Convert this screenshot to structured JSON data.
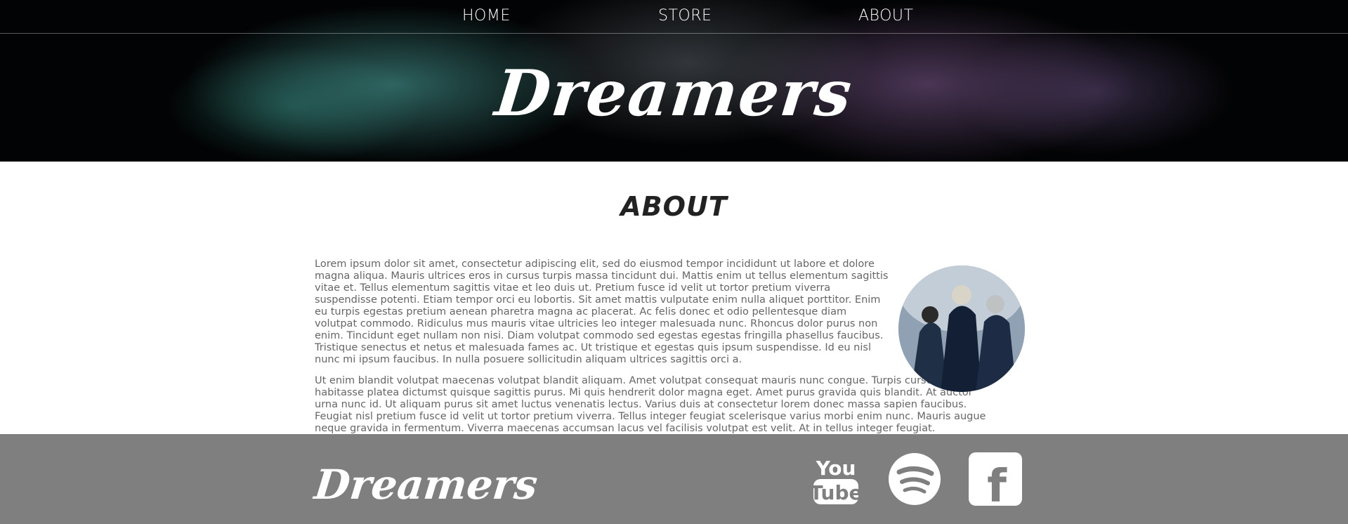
{
  "nav": {
    "items": [
      {
        "label": "HOME"
      },
      {
        "label": "STORE"
      },
      {
        "label": "ABOUT"
      }
    ]
  },
  "hero": {
    "title": "Dreamers"
  },
  "about": {
    "heading": "ABOUT",
    "paragraphs": [
      "Lorem ipsum dolor sit amet, consectetur adipiscing elit, sed do eiusmod tempor incididunt ut labore et dolore magna aliqua. Mauris ultrices eros in cursus turpis massa tincidunt dui. Mattis enim ut tellus elementum sagittis vitae et. Tellus elementum sagittis vitae et leo duis ut. Pretium fusce id velit ut tortor pretium viverra suspendisse potenti. Etiam tempor orci eu lobortis. Sit amet mattis vulputate enim nulla aliquet porttitor. Enim eu turpis egestas pretium aenean pharetra magna ac placerat. Ac felis donec et odio pellentesque diam volutpat commodo. Ridiculus mus mauris vitae ultricies leo integer malesuada nunc. Rhoncus dolor purus non enim. Tincidunt eget nullam non nisi. Diam volutpat commodo sed egestas egestas fringilla phasellus faucibus. Tristique senectus et netus et malesuada fames ac. Ut tristique et egestas quis ipsum suspendisse. Id eu nisl nunc mi ipsum faucibus. In nulla posuere sollicitudin aliquam ultrices sagittis orci a.",
      "Ut enim blandit volutpat maecenas volutpat blandit aliquam. Amet volutpat consequat mauris nunc congue. Turpis cursus in hac habitasse platea dictumst quisque sagittis purus. Mi quis hendrerit dolor magna eget. Amet purus gravida quis blandit. At auctor urna nunc id. Ut aliquam purus sit amet luctus venenatis lectus. Varius duis at consectetur lorem donec massa sapien faucibus. Feugiat nisl pretium fusce id velit ut tortor pretium viverra. Tellus integer feugiat scelerisque varius morbi enim nunc. Mauris augue neque gravida in fermentum. Viverra maecenas accumsan lacus vel facilisis volutpat est velit. At in tellus integer feugiat."
    ]
  },
  "footer": {
    "logo": "Dreamers",
    "social": [
      {
        "icon": "youtube-icon",
        "text_top": "You",
        "text_bottom": "Tube"
      },
      {
        "icon": "spotify-icon"
      },
      {
        "icon": "facebook-icon",
        "text": "f"
      }
    ]
  },
  "colors": {
    "footer_bg": "#7f7f7f",
    "hero_bg": "#020304",
    "text": "#666666",
    "heading": "#222222"
  }
}
